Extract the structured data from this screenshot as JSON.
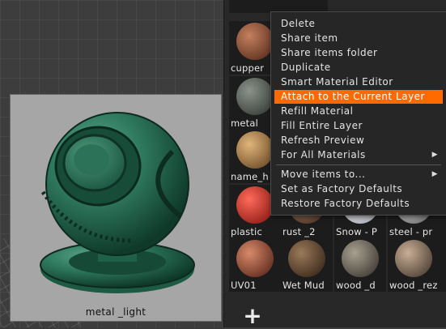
{
  "preview": {
    "label": "metal _light"
  },
  "palette": {
    "tiles_row0": [
      "",
      "",
      "",
      ""
    ],
    "tiles_row1": [
      {
        "label": "cupper",
        "color": "#6e3a22"
      }
    ],
    "tiles_row2": [
      {
        "label": "metal",
        "color": "#4a4f48"
      }
    ],
    "tiles_row3": [
      {
        "label": "name_h",
        "color": "#9a7a4a"
      }
    ],
    "tiles_row4": [
      {
        "label": "plastic",
        "color": "#b3231b"
      },
      {
        "label": "rust _2",
        "color": "#6a4a3a"
      },
      {
        "label": "Snow - P",
        "color": "#cfd2d8"
      },
      {
        "label": "steel - pr",
        "color": "#a8a8a8"
      }
    ],
    "tiles_row5": [
      {
        "label": "UV01",
        "color": "#8a4a3a"
      },
      {
        "label": "Wet Mud",
        "color": "#5a4332"
      },
      {
        "label": "wood _d",
        "color": "#5a554e"
      },
      {
        "label": "wood _rez",
        "color": "#7a6654"
      }
    ],
    "add_label": "+"
  },
  "context_menu": {
    "items": [
      {
        "label": "Delete"
      },
      {
        "label": "Share item"
      },
      {
        "label": "Share items folder"
      },
      {
        "label": "Duplicate"
      },
      {
        "label": "Smart Material Editor"
      },
      {
        "label": "Attach to the Current Layer",
        "active": true
      },
      {
        "label": "Refill Material"
      },
      {
        "label": "Fill Entire Layer"
      },
      {
        "label": "Refresh Preview"
      },
      {
        "label": "For All Materials",
        "submenu": true
      },
      {
        "label": "Move items to...",
        "submenu": true
      },
      {
        "label": "Set as Factory Defaults"
      },
      {
        "label": "Restore Factory Defaults"
      }
    ],
    "active_color": "#ff6a00"
  }
}
